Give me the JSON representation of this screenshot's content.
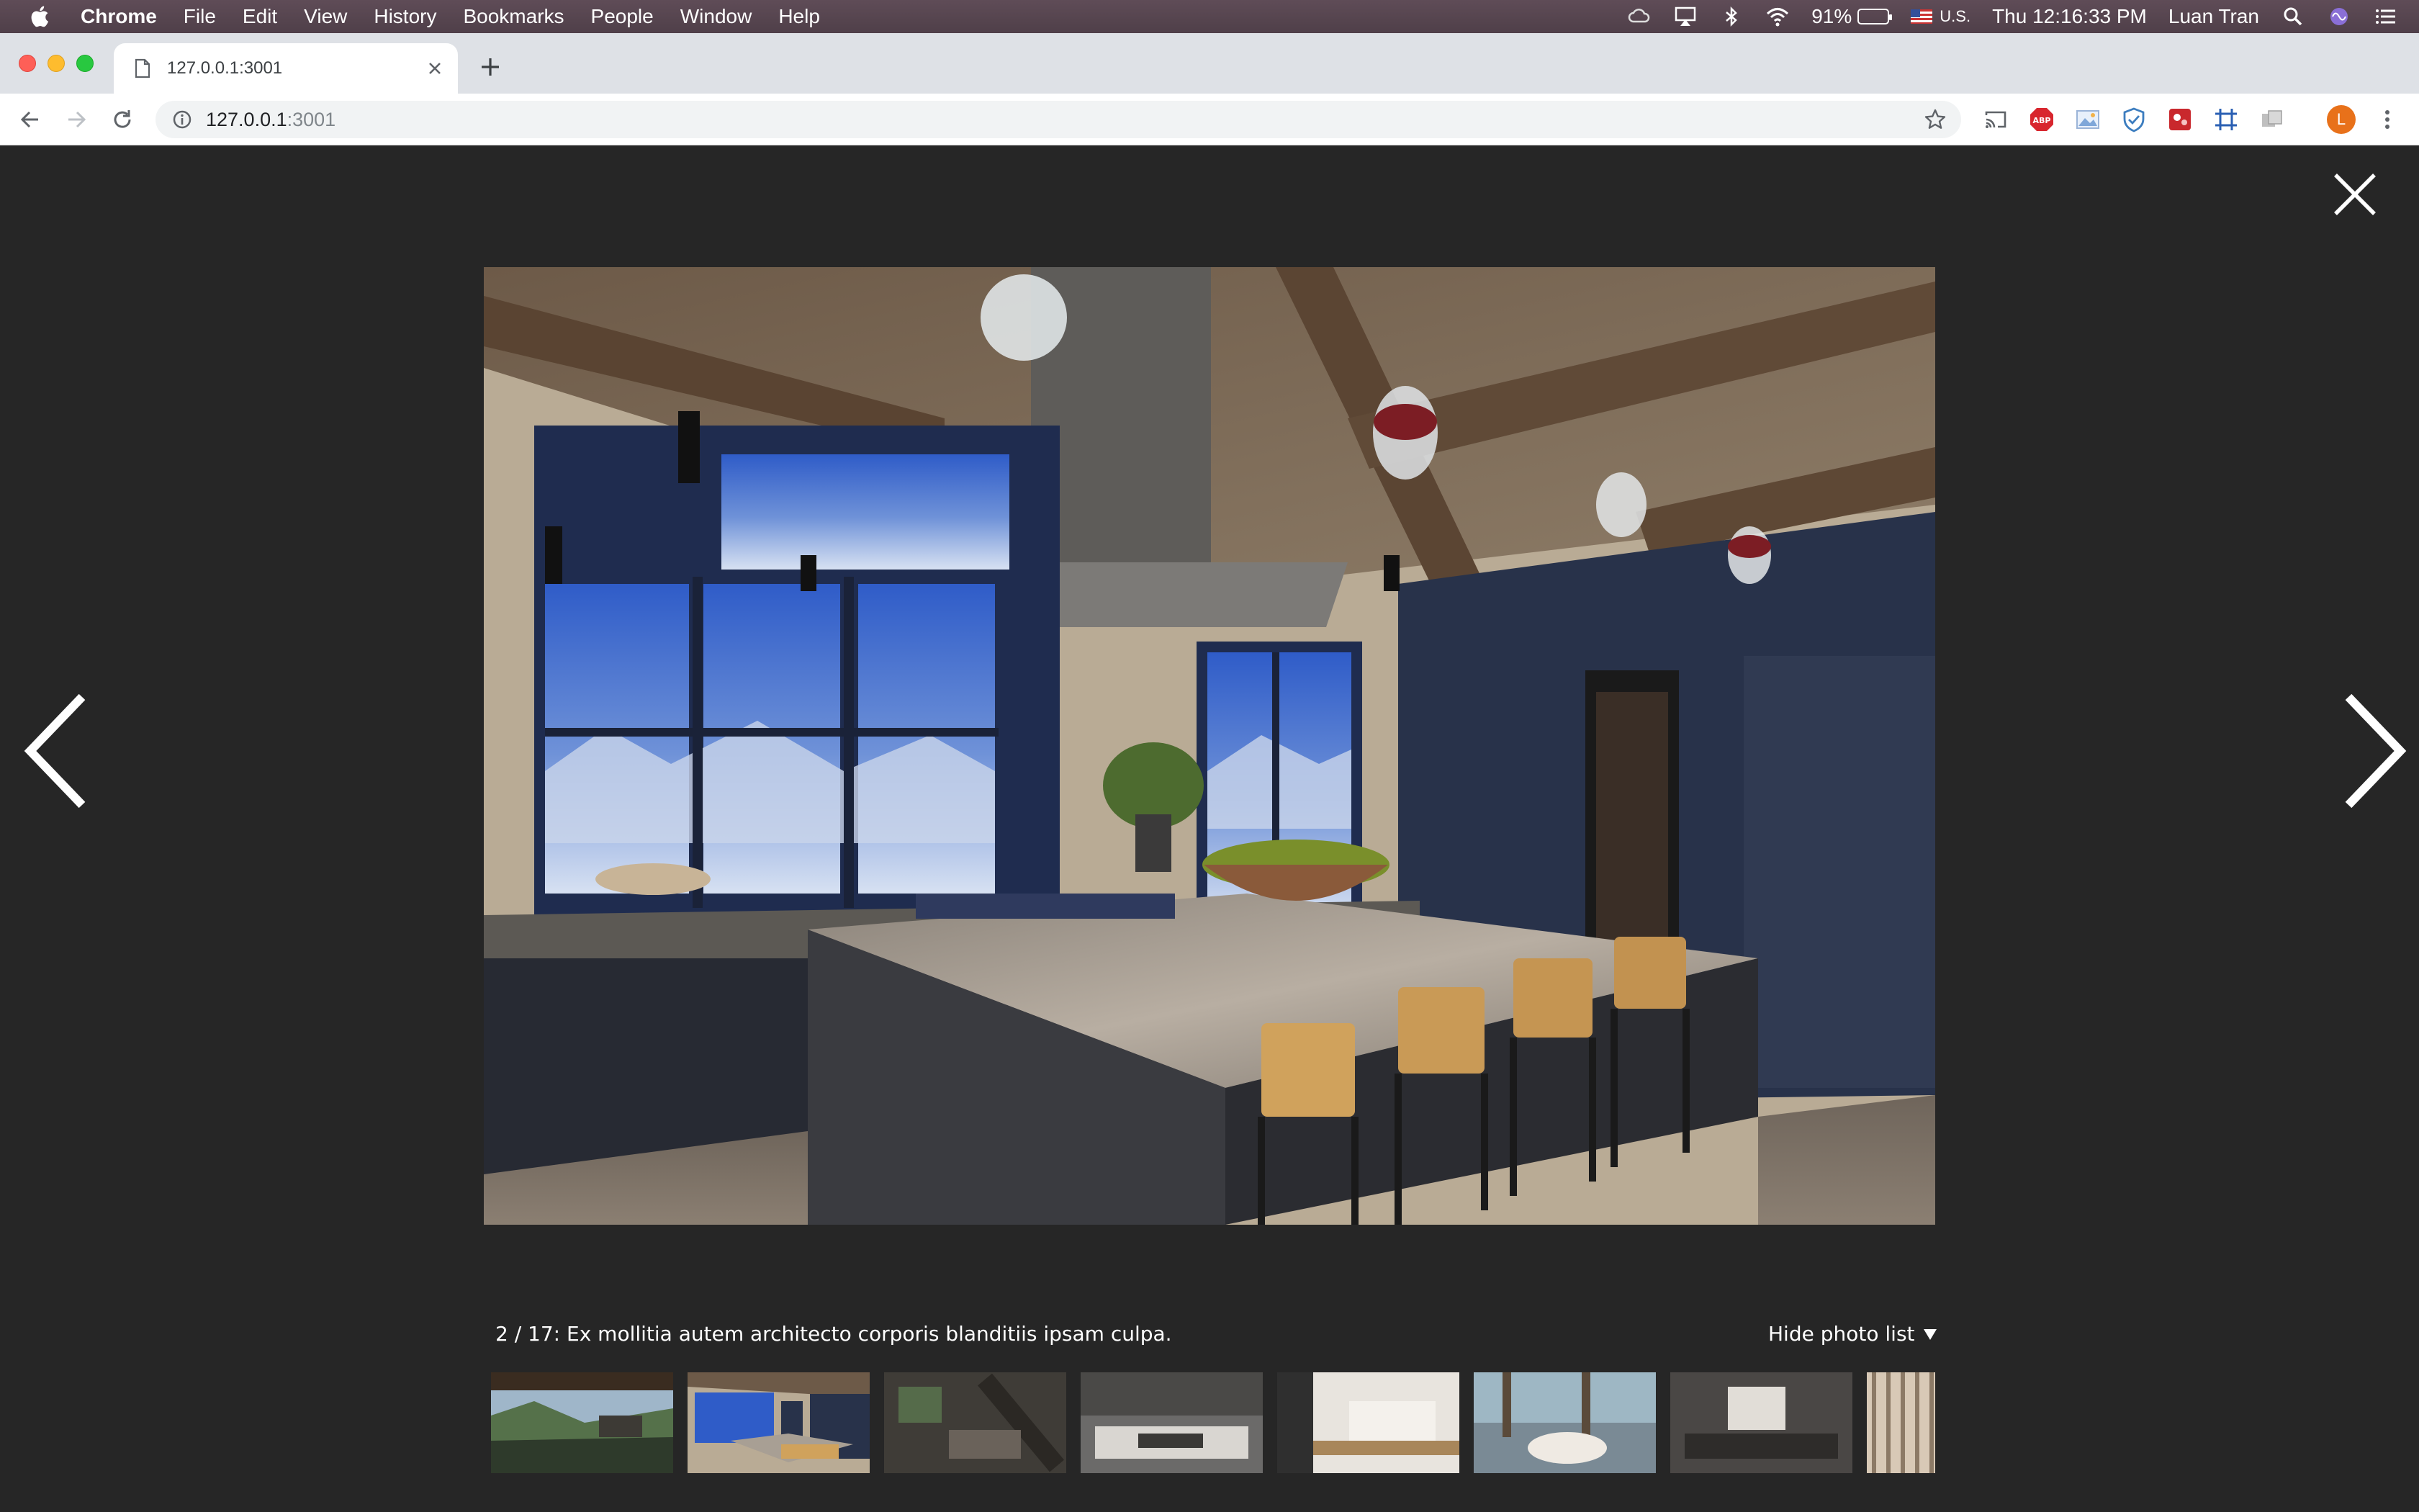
{
  "menubar": {
    "app_name": "Chrome",
    "items": [
      "File",
      "Edit",
      "View",
      "History",
      "Bookmarks",
      "People",
      "Window",
      "Help"
    ],
    "battery_percent": "91%",
    "battery_level": 0.91,
    "input_source": "U.S.",
    "clock": "Thu 12:16:33 PM",
    "user": "Luan Tran",
    "status_icons": [
      "creative-cloud-icon",
      "airplay-icon",
      "bluetooth-icon",
      "wifi-icon",
      "spotlight-icon",
      "siri-icon",
      "notification-center-icon"
    ]
  },
  "browser": {
    "tab": {
      "title": "127.0.0.1:3001"
    },
    "address": {
      "host": "127.0.0.1",
      "port": ":3001"
    },
    "profile_initial": "L",
    "extensions": [
      "cast-icon",
      "adblock-plus-icon",
      "image-extension-icon",
      "shield-extension-icon",
      "red-extension-icon",
      "grid-extension-icon",
      "gray-extension-icon"
    ]
  },
  "viewer": {
    "caption": "2 / 17: Ex mollitia autem architecto corporis blanditiis ipsam culpa.",
    "current_index": 2,
    "total": 17,
    "toggle_label": "Hide photo list",
    "toggle_icon": "triangle-down-icon",
    "thumbnails": [
      {
        "label": "thumbnail-1",
        "selected": false
      },
      {
        "label": "thumbnail-2",
        "selected": true
      },
      {
        "label": "thumbnail-3",
        "selected": false
      },
      {
        "label": "thumbnail-4",
        "selected": false
      },
      {
        "label": "thumbnail-5",
        "selected": false
      },
      {
        "label": "thumbnail-6",
        "selected": false
      },
      {
        "label": "thumbnail-7",
        "selected": false
      },
      {
        "label": "thumbnail-8",
        "selected": false
      }
    ]
  },
  "colors": {
    "viewer_background": "#262626",
    "menubar": "#55434e",
    "tabstrip": "#dee1e6",
    "profile": "#e8711a"
  }
}
